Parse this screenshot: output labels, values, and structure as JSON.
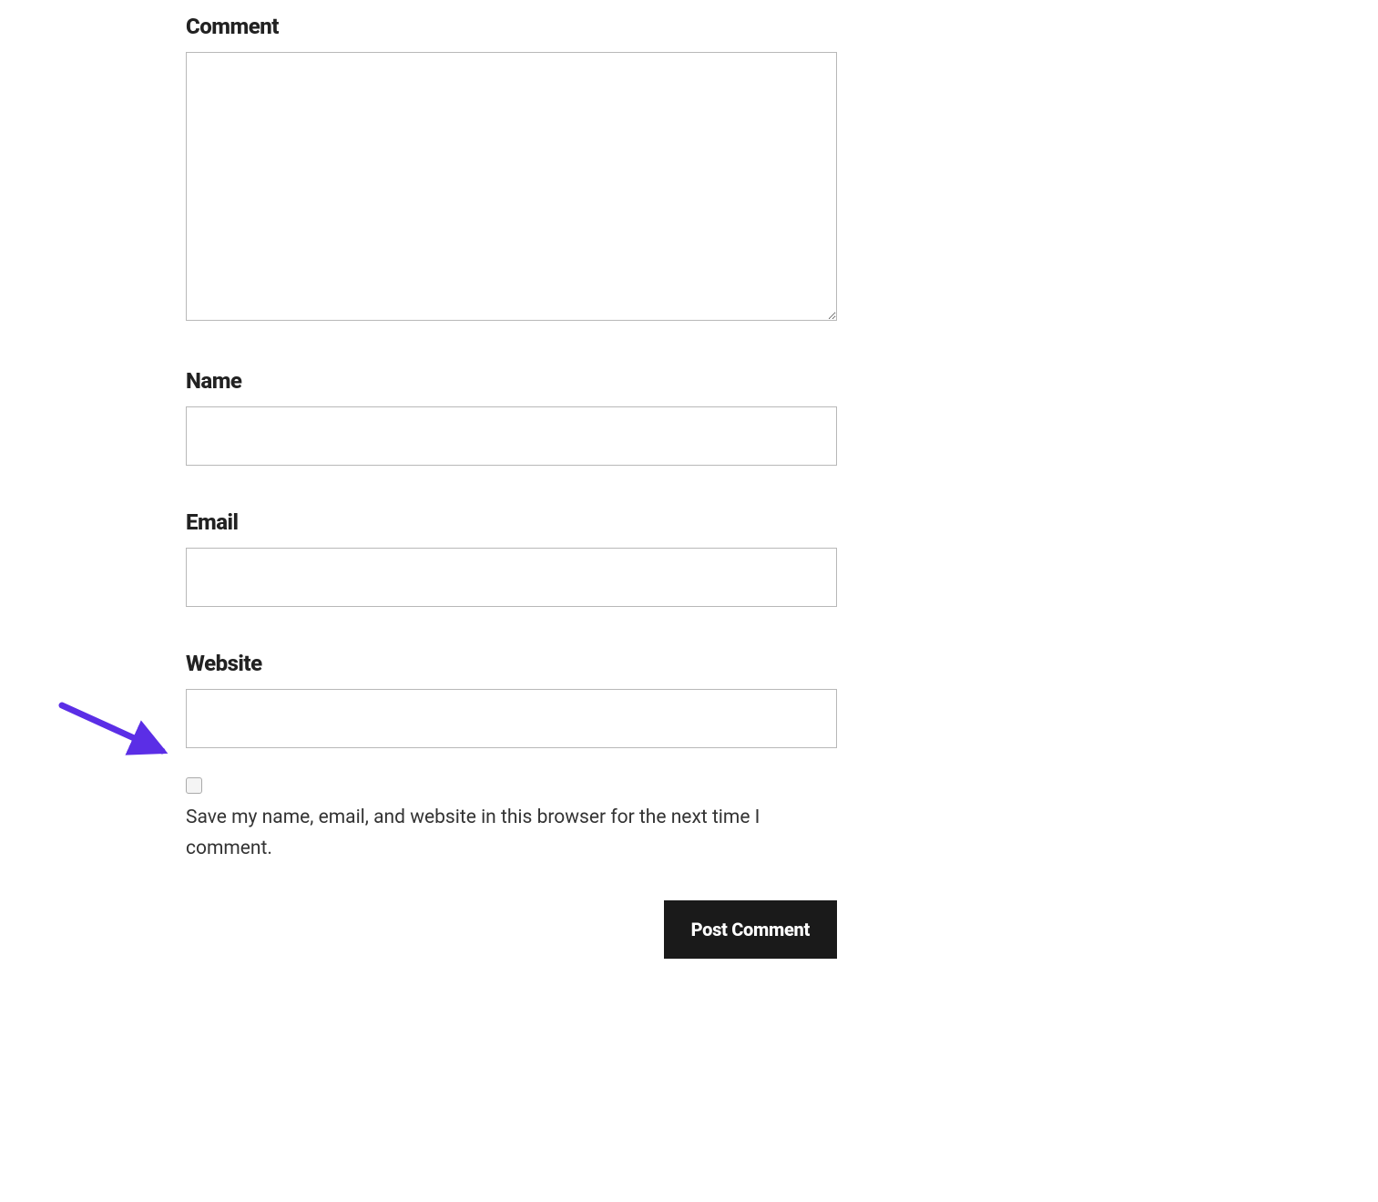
{
  "form": {
    "comment_label": "Comment",
    "name_label": "Name",
    "email_label": "Email",
    "website_label": "Website",
    "save_info_label": "Save my name, email, and website in this browser for the next time I comment.",
    "submit_label": "Post Comment"
  },
  "annotation": {
    "arrow_color": "#5b2ee6"
  }
}
